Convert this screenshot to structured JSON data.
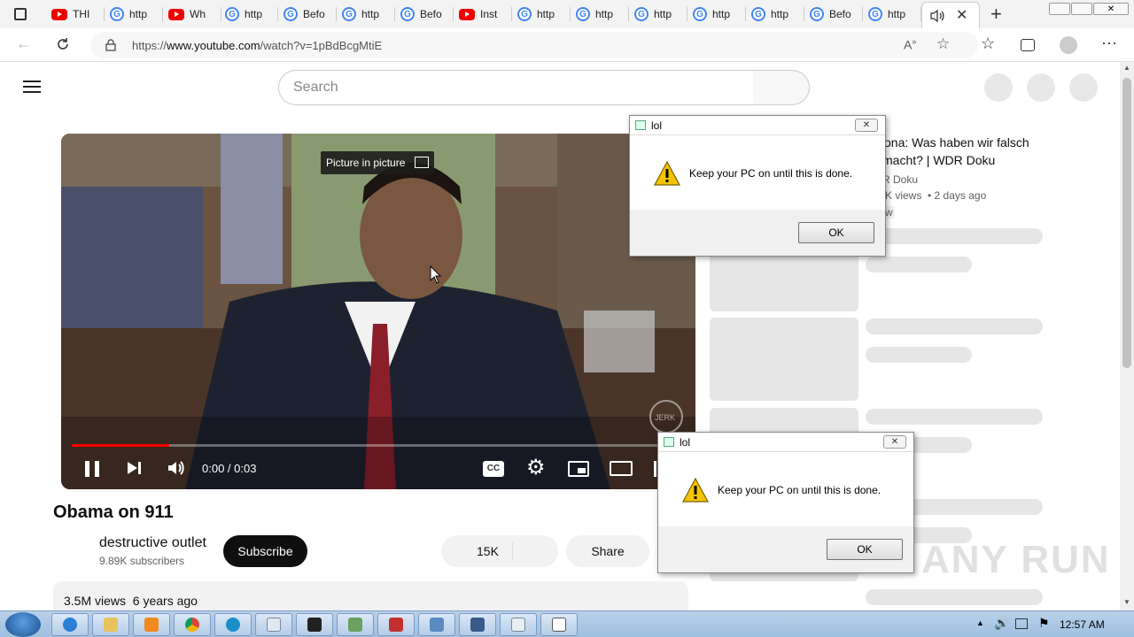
{
  "browser": {
    "tabs": [
      {
        "label": "THI",
        "icon": "youtube-icon"
      },
      {
        "label": "http",
        "icon": "google-icon"
      },
      {
        "label": "Wh",
        "icon": "youtube-icon"
      },
      {
        "label": "http",
        "icon": "google-icon"
      },
      {
        "label": "Befo",
        "icon": "google-icon"
      },
      {
        "label": "http",
        "icon": "google-icon"
      },
      {
        "label": "Befo",
        "icon": "google-icon"
      },
      {
        "label": "Inst",
        "icon": "youtube-icon"
      },
      {
        "label": "http",
        "icon": "google-icon"
      },
      {
        "label": "http",
        "icon": "google-icon"
      },
      {
        "label": "http",
        "icon": "google-icon"
      },
      {
        "label": "http",
        "icon": "google-icon"
      },
      {
        "label": "http",
        "icon": "google-icon"
      },
      {
        "label": "Befo",
        "icon": "google-icon"
      },
      {
        "label": "http",
        "icon": "google-icon"
      }
    ],
    "url_prefix": "https://",
    "url_host": "www.youtube.com",
    "url_path": "/watch?v=1pBdBcgMtiE"
  },
  "youtube": {
    "search_placeholder": "Search",
    "pip_tooltip": "Picture in picture",
    "time": "0:00 / 0:03",
    "progress_fraction": 0.16,
    "video_title": "Obama on 911",
    "channel_name": "destructive outlet",
    "subscribers": "9.89K subscribers",
    "subscribe_label": "Subscribe",
    "likes": "15K",
    "share_label": "Share",
    "views": "3.5M views  6 years ago",
    "watermark_logo": "JERK"
  },
  "recommendation": {
    "title_line1": "ona: Was haben wir falsch",
    "title_line2": "macht? | WDR Doku",
    "channel": "R Doku",
    "meta": "K views  • 2 days ago",
    "badge": "w"
  },
  "dialogs": [
    {
      "title": "lol",
      "message": "Keep your PC on until this is done.",
      "ok": "OK"
    },
    {
      "title": "lol",
      "message": "Keep your PC on until this is done.",
      "ok": "OK"
    }
  ],
  "watermark": "ANY RUN",
  "taskbar": {
    "clock": "12:57 AM"
  },
  "colors": {
    "youtube_red": "#ff0000",
    "subscribe_bg": "#0f0f0f",
    "taskbar": "#b9d1ea"
  }
}
